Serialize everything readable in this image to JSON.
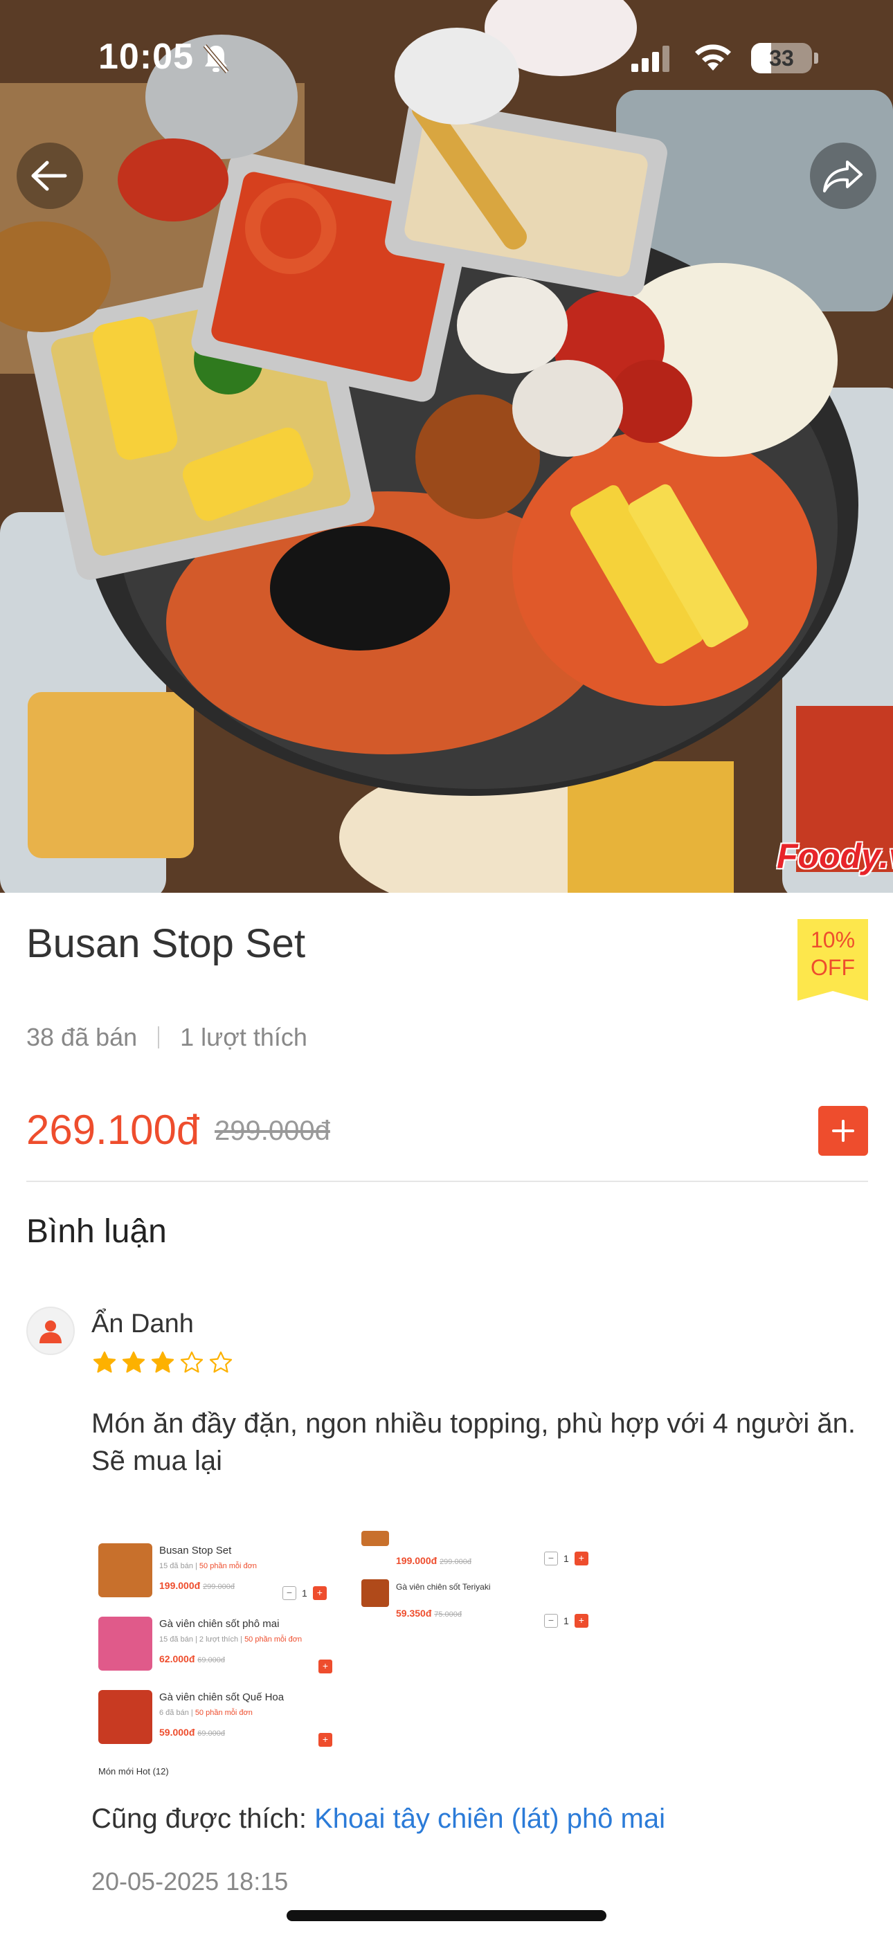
{
  "status_bar": {
    "time": "10:05",
    "battery": "33",
    "battery_level": 0.33
  },
  "hero": {
    "watermark": "Foody.vn"
  },
  "product": {
    "title": "Busan Stop Set",
    "discount_line1": "10%",
    "discount_line2": "OFF",
    "sold": "38 đã bán",
    "likes": "1 lượt thích",
    "price": "269.100đ",
    "old_price": "299.000đ"
  },
  "reviews": {
    "section_title": "Bình luận",
    "items": [
      {
        "name": "Ẩn Danh",
        "rating": 3,
        "max_rating": 5,
        "text": "Món ăn đầy đặn, ngon nhiều topping, phù hợp với 4 người ăn. Sẽ mua lại",
        "screenshot": {
          "items": [
            {
              "name": "Busan Stop Set",
              "sold": "15 đã bán",
              "tag": "50 phần mỗi đơn",
              "price": "199.000đ",
              "old": "299.000đ",
              "qty": "1"
            },
            {
              "name": "Gà viên chiên sốt phô mai",
              "sold": "15 đã bán",
              "likes": "2 lượt thích",
              "tag": "50 phần mỗi đơn",
              "price": "62.000đ",
              "old": "69.000đ"
            },
            {
              "name": "Gà viên chiên sốt Quế Hoa",
              "sold": "6 đã bán",
              "tag": "50 phần mỗi đơn",
              "price": "59.000đ",
              "old": "69.000đ"
            },
            {
              "name": "",
              "price": "199.000đ",
              "old": "299.000đ",
              "qty": "1"
            },
            {
              "name": "Gà viên chiên sốt Teriyaki",
              "price": "59.350đ",
              "old": "75.000đ",
              "qty": "1"
            }
          ],
          "footer": "Món mới Hot (12)"
        },
        "also_like_label": "Cũng được thích:",
        "also_like_item": "Khoai tây chiên (lát) phô mai",
        "date": "20-05-2025 18:15"
      }
    ]
  }
}
